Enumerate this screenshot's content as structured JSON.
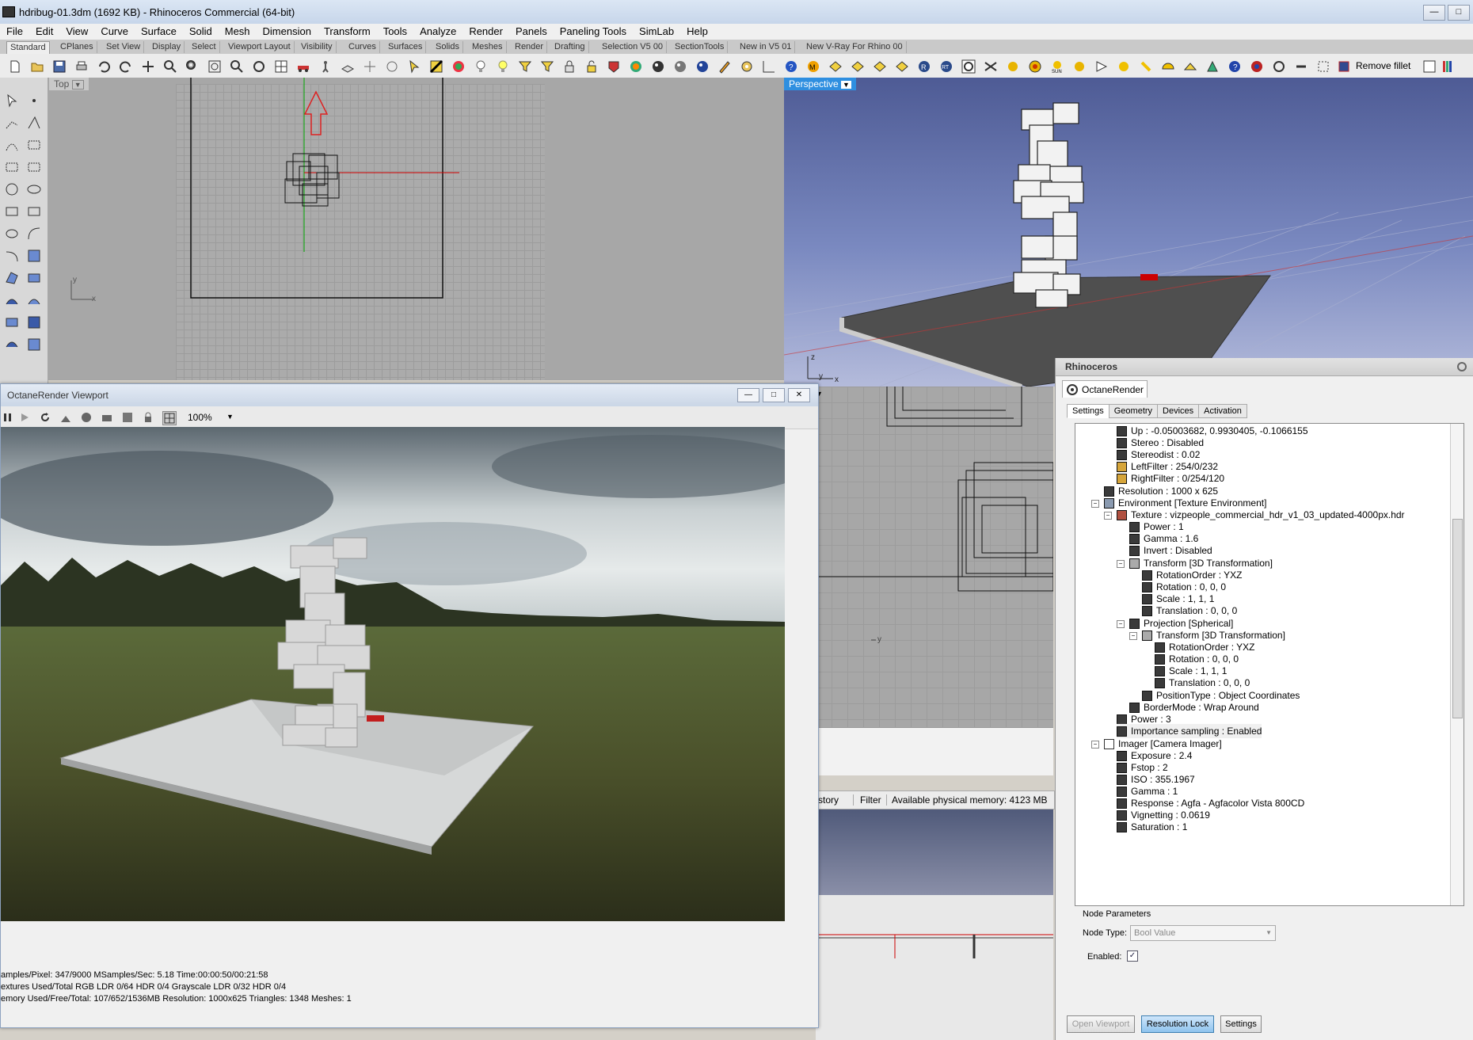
{
  "window": {
    "title": "hdribug-01.3dm (1692 KB) - Rhinoceros Commercial (64-bit)"
  },
  "menu": [
    "File",
    "Edit",
    "View",
    "Curve",
    "Surface",
    "Solid",
    "Mesh",
    "Dimension",
    "Transform",
    "Tools",
    "Analyze",
    "Render",
    "Panels",
    "Paneling Tools",
    "SimLab",
    "Help"
  ],
  "toolbar_tabs": [
    "Standard",
    "CPlanes",
    "Set View",
    "Display",
    "Select",
    "Viewport Layout",
    "Visibility",
    "Curves",
    "Surfaces",
    "Solids",
    "Meshes",
    "Render",
    "Drafting",
    "Selection V5 00",
    "SectionTools",
    "New in V5 01",
    "New V-Ray For Rhino 00"
  ],
  "toolbar": {
    "remove_fillet": "Remove fillet"
  },
  "viewports": {
    "top": {
      "label": "Top",
      "axis_x": "x",
      "axis_y": "y"
    },
    "perspective": {
      "label": "Perspective",
      "axis_x": "x",
      "axis_y": "y",
      "axis_z": "z"
    },
    "front": {
      "axis_y": "y"
    }
  },
  "status": {
    "tab_partial": "story",
    "filter": "Filter",
    "memory": "Available physical memory: 4123 MB"
  },
  "octane": {
    "window_title": "OctaneRender Viewport",
    "zoom": "100%",
    "stats": [
      "amples/Pixel: 347/9000  MSamples/Sec: 5.18  Time:00:00:50/00:21:58",
      "extures Used/Total RGB LDR 0/64  HDR 0/4  Grayscale LDR 0/32  HDR 0/4",
      "emory Used/Free/Total: 107/652/1536MB  Resolution: 1000x625  Triangles: 1348  Meshes: 1"
    ]
  },
  "panel": {
    "title": "Rhinoceros",
    "tab": "OctaneRender",
    "subtabs": [
      "Settings",
      "Geometry",
      "Devices",
      "Activation"
    ],
    "tree": [
      {
        "text": "Up : -0.05003682, 0.9930405, -0.1066155",
        "icon": "value"
      },
      {
        "text": "Stereo : Disabled",
        "icon": "bool"
      },
      {
        "text": "Stereodist : 0.02",
        "icon": "value"
      },
      {
        "text": "LeftFilter : 254/0/232",
        "icon": "color"
      },
      {
        "text": "RightFilter : 0/254/120",
        "icon": "color"
      },
      {
        "text": "Resolution : 1000 x 625",
        "icon": "value"
      },
      {
        "text": "Environment  [Texture Environment]",
        "icon": "env"
      },
      {
        "text": "Texture : vizpeople_commercial_hdr_v1_03_updated-4000px.hdr",
        "icon": "texture"
      },
      {
        "text": "Power : 1",
        "icon": "value"
      },
      {
        "text": "Gamma : 1.6",
        "icon": "value"
      },
      {
        "text": "Invert : Disabled",
        "icon": "bool"
      },
      {
        "text": "Transform  [3D Transformation]",
        "icon": "transform"
      },
      {
        "text": "RotationOrder : YXZ",
        "icon": "value"
      },
      {
        "text": "Rotation : 0, 0, 0",
        "icon": "value"
      },
      {
        "text": "Scale : 1, 1, 1",
        "icon": "value"
      },
      {
        "text": "Translation : 0, 0, 0",
        "icon": "value"
      },
      {
        "text": "Projection  [Spherical]",
        "icon": "value"
      },
      {
        "text": "Transform  [3D Transformation]",
        "icon": "transform"
      },
      {
        "text": "RotationOrder : YXZ",
        "icon": "value"
      },
      {
        "text": "Rotation : 0, 0, 0",
        "icon": "value"
      },
      {
        "text": "Scale : 1, 1, 1",
        "icon": "value"
      },
      {
        "text": "Translation : 0, 0, 0",
        "icon": "value"
      },
      {
        "text": "PositionType : Object Coordinates",
        "icon": "value"
      },
      {
        "text": "BorderMode : Wrap Around",
        "icon": "value"
      },
      {
        "text": "Power : 3",
        "icon": "value"
      },
      {
        "text": "Importance sampling : Enabled",
        "icon": "bool"
      },
      {
        "text": "Imager  [Camera Imager]",
        "icon": "imager"
      },
      {
        "text": "Exposure : 2.4",
        "icon": "value"
      },
      {
        "text": "Fstop : 2",
        "icon": "value"
      },
      {
        "text": "ISO : 355.1967",
        "icon": "value"
      },
      {
        "text": "Gamma : 1",
        "icon": "value"
      },
      {
        "text": "Response : Agfa - Agfacolor Vista 800CD",
        "icon": "value"
      },
      {
        "text": "Vignetting : 0.0619",
        "icon": "value"
      },
      {
        "text": "Saturation : 1",
        "icon": "value"
      }
    ],
    "node_params": {
      "heading": "Node Parameters",
      "type_label": "Node Type:",
      "type_value": "Bool Value",
      "enabled_label": "Enabled:"
    },
    "buttons": {
      "open_viewport": "Open Viewport",
      "resolution_lock": "Resolution Lock",
      "settings": "Settings"
    }
  }
}
